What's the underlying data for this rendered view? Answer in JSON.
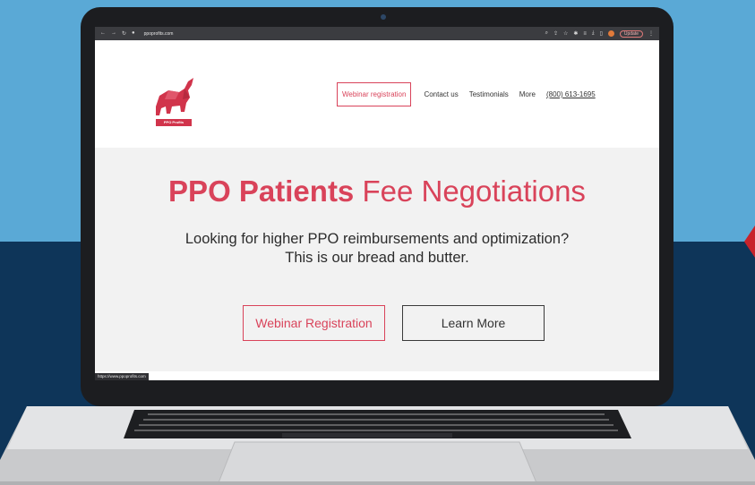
{
  "browser": {
    "url": "ppoprofits.com",
    "update_label": "Update",
    "status_url": "https://www.ppoprofits.com"
  },
  "logo": {
    "banner_text": "PPO Profits"
  },
  "nav": {
    "webinar": "Webinar registration",
    "contact": "Contact us",
    "testimonials": "Testimonials",
    "more": "More",
    "phone": "(800) 613-1695"
  },
  "hero": {
    "title_bold": "PPO Patients",
    "title_rest": " Fee Negotiations",
    "subtitle_line1": "Looking for higher PPO reimbursements and optimization?",
    "subtitle_line2": "This is our bread and butter.",
    "webinar_button": "Webinar Registration",
    "learn_button": "Learn More"
  },
  "colors": {
    "brand_red": "#d9435a",
    "bg_blue": "#5aa9d6",
    "bg_navy": "#0e3559"
  }
}
